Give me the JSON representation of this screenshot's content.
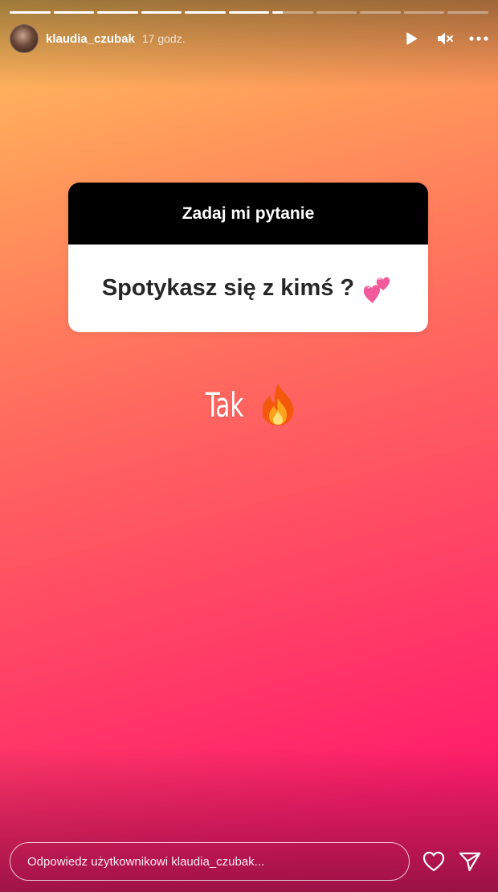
{
  "story": {
    "progress_segments": [
      {
        "filled": 1.0
      },
      {
        "filled": 1.0
      },
      {
        "filled": 1.0
      },
      {
        "filled": 1.0
      },
      {
        "filled": 1.0
      },
      {
        "filled": 1.0
      },
      {
        "filled": 0.25
      },
      {
        "filled": 0.0
      },
      {
        "filled": 0.0
      },
      {
        "filled": 0.0
      },
      {
        "filled": 0.0
      }
    ]
  },
  "header": {
    "username": "klaudia_czubak",
    "time": "17 godz.",
    "icons": [
      "play-icon",
      "mute-icon",
      "more-icon"
    ]
  },
  "question_card": {
    "title": "Zadaj mi pytanie",
    "question": "Spotykasz się z kimś ?",
    "emoji": "two-hearts-emoji"
  },
  "answer": {
    "text": "Tak",
    "emoji": "fire-emoji"
  },
  "reply": {
    "placeholder": "Odpowiedz użytkownikowi klaudia_czubak...",
    "icons": [
      "heart-icon",
      "send-icon"
    ]
  },
  "colors": {
    "gradient_top": "#ffc35e",
    "gradient_mid": "#ff6a5e",
    "gradient_bottom": "#ff1d6b",
    "card_header": "#000000",
    "card_body": "#ffffff"
  }
}
